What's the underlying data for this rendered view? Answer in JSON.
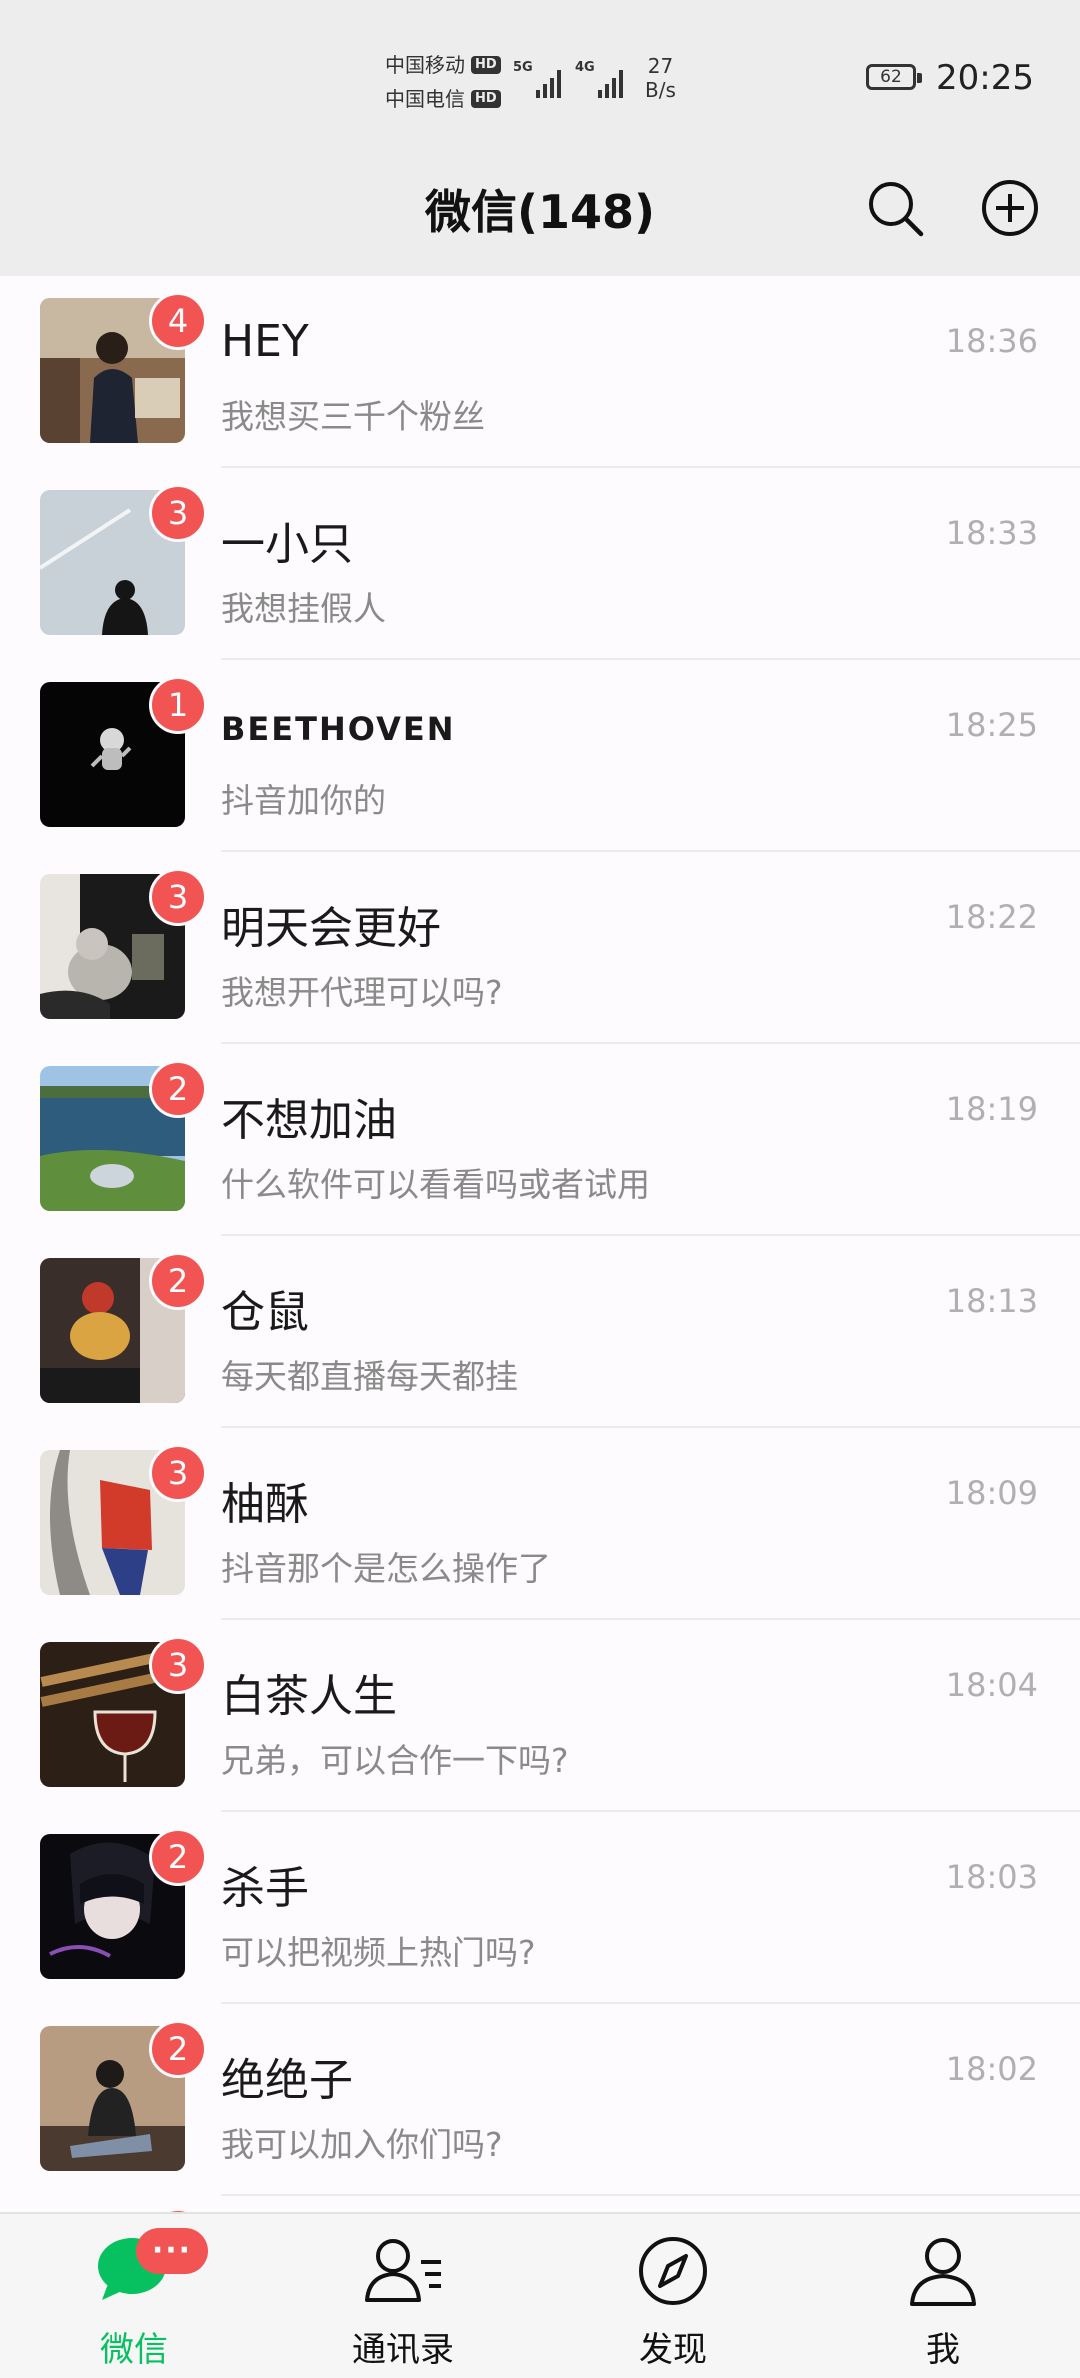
{
  "status_bar": {
    "carrier1": "中国移动",
    "carrier2": "中国电信",
    "hd": "HD",
    "net1": "5G",
    "net2": "4G",
    "speed_value": "27",
    "speed_unit": "B/s",
    "battery": "62",
    "time": "20:25"
  },
  "header": {
    "title": "微信(148)",
    "search_icon": "search-icon",
    "add_icon": "plus-circle-icon"
  },
  "chats": [
    {
      "name": "HEY",
      "preview": "我想买三千个粉丝",
      "time": "18:36",
      "badge": "4"
    },
    {
      "name": "一小只",
      "preview": "我想挂假人",
      "time": "18:33",
      "badge": "3"
    },
    {
      "name": "BEETHOVEN",
      "preview": "抖音加你的",
      "time": "18:25",
      "badge": "1"
    },
    {
      "name": "明天会更好",
      "preview": "我想开代理可以吗?",
      "time": "18:22",
      "badge": "3"
    },
    {
      "name": "不想加油",
      "preview": "什么软件可以看看吗或者试用",
      "time": "18:19",
      "badge": "2"
    },
    {
      "name": "仓鼠",
      "preview": "每天都直播每天都挂",
      "time": "18:13",
      "badge": "2"
    },
    {
      "name": "柚酥",
      "preview": "抖音那个是怎么操作了",
      "time": "18:09",
      "badge": "3"
    },
    {
      "name": "白茶人生",
      "preview": "兄弟，可以合作一下吗?",
      "time": "18:04",
      "badge": "3"
    },
    {
      "name": "杀手",
      "preview": "可以把视频上热门吗?",
      "time": "18:03",
      "badge": "2"
    },
    {
      "name": "绝绝子",
      "preview": "我可以加入你们吗?",
      "time": "18:02",
      "badge": "2"
    }
  ],
  "tabbar": {
    "tabs": [
      {
        "label": "微信",
        "icon": "chat-bubble-icon",
        "active": true,
        "dots": "···"
      },
      {
        "label": "通讯录",
        "icon": "contacts-icon"
      },
      {
        "label": "发现",
        "icon": "compass-icon"
      },
      {
        "label": "我",
        "icon": "person-icon"
      }
    ]
  },
  "colors": {
    "accent_green": "#07c160",
    "badge_red": "#f25454",
    "header_bg": "#ededed"
  }
}
